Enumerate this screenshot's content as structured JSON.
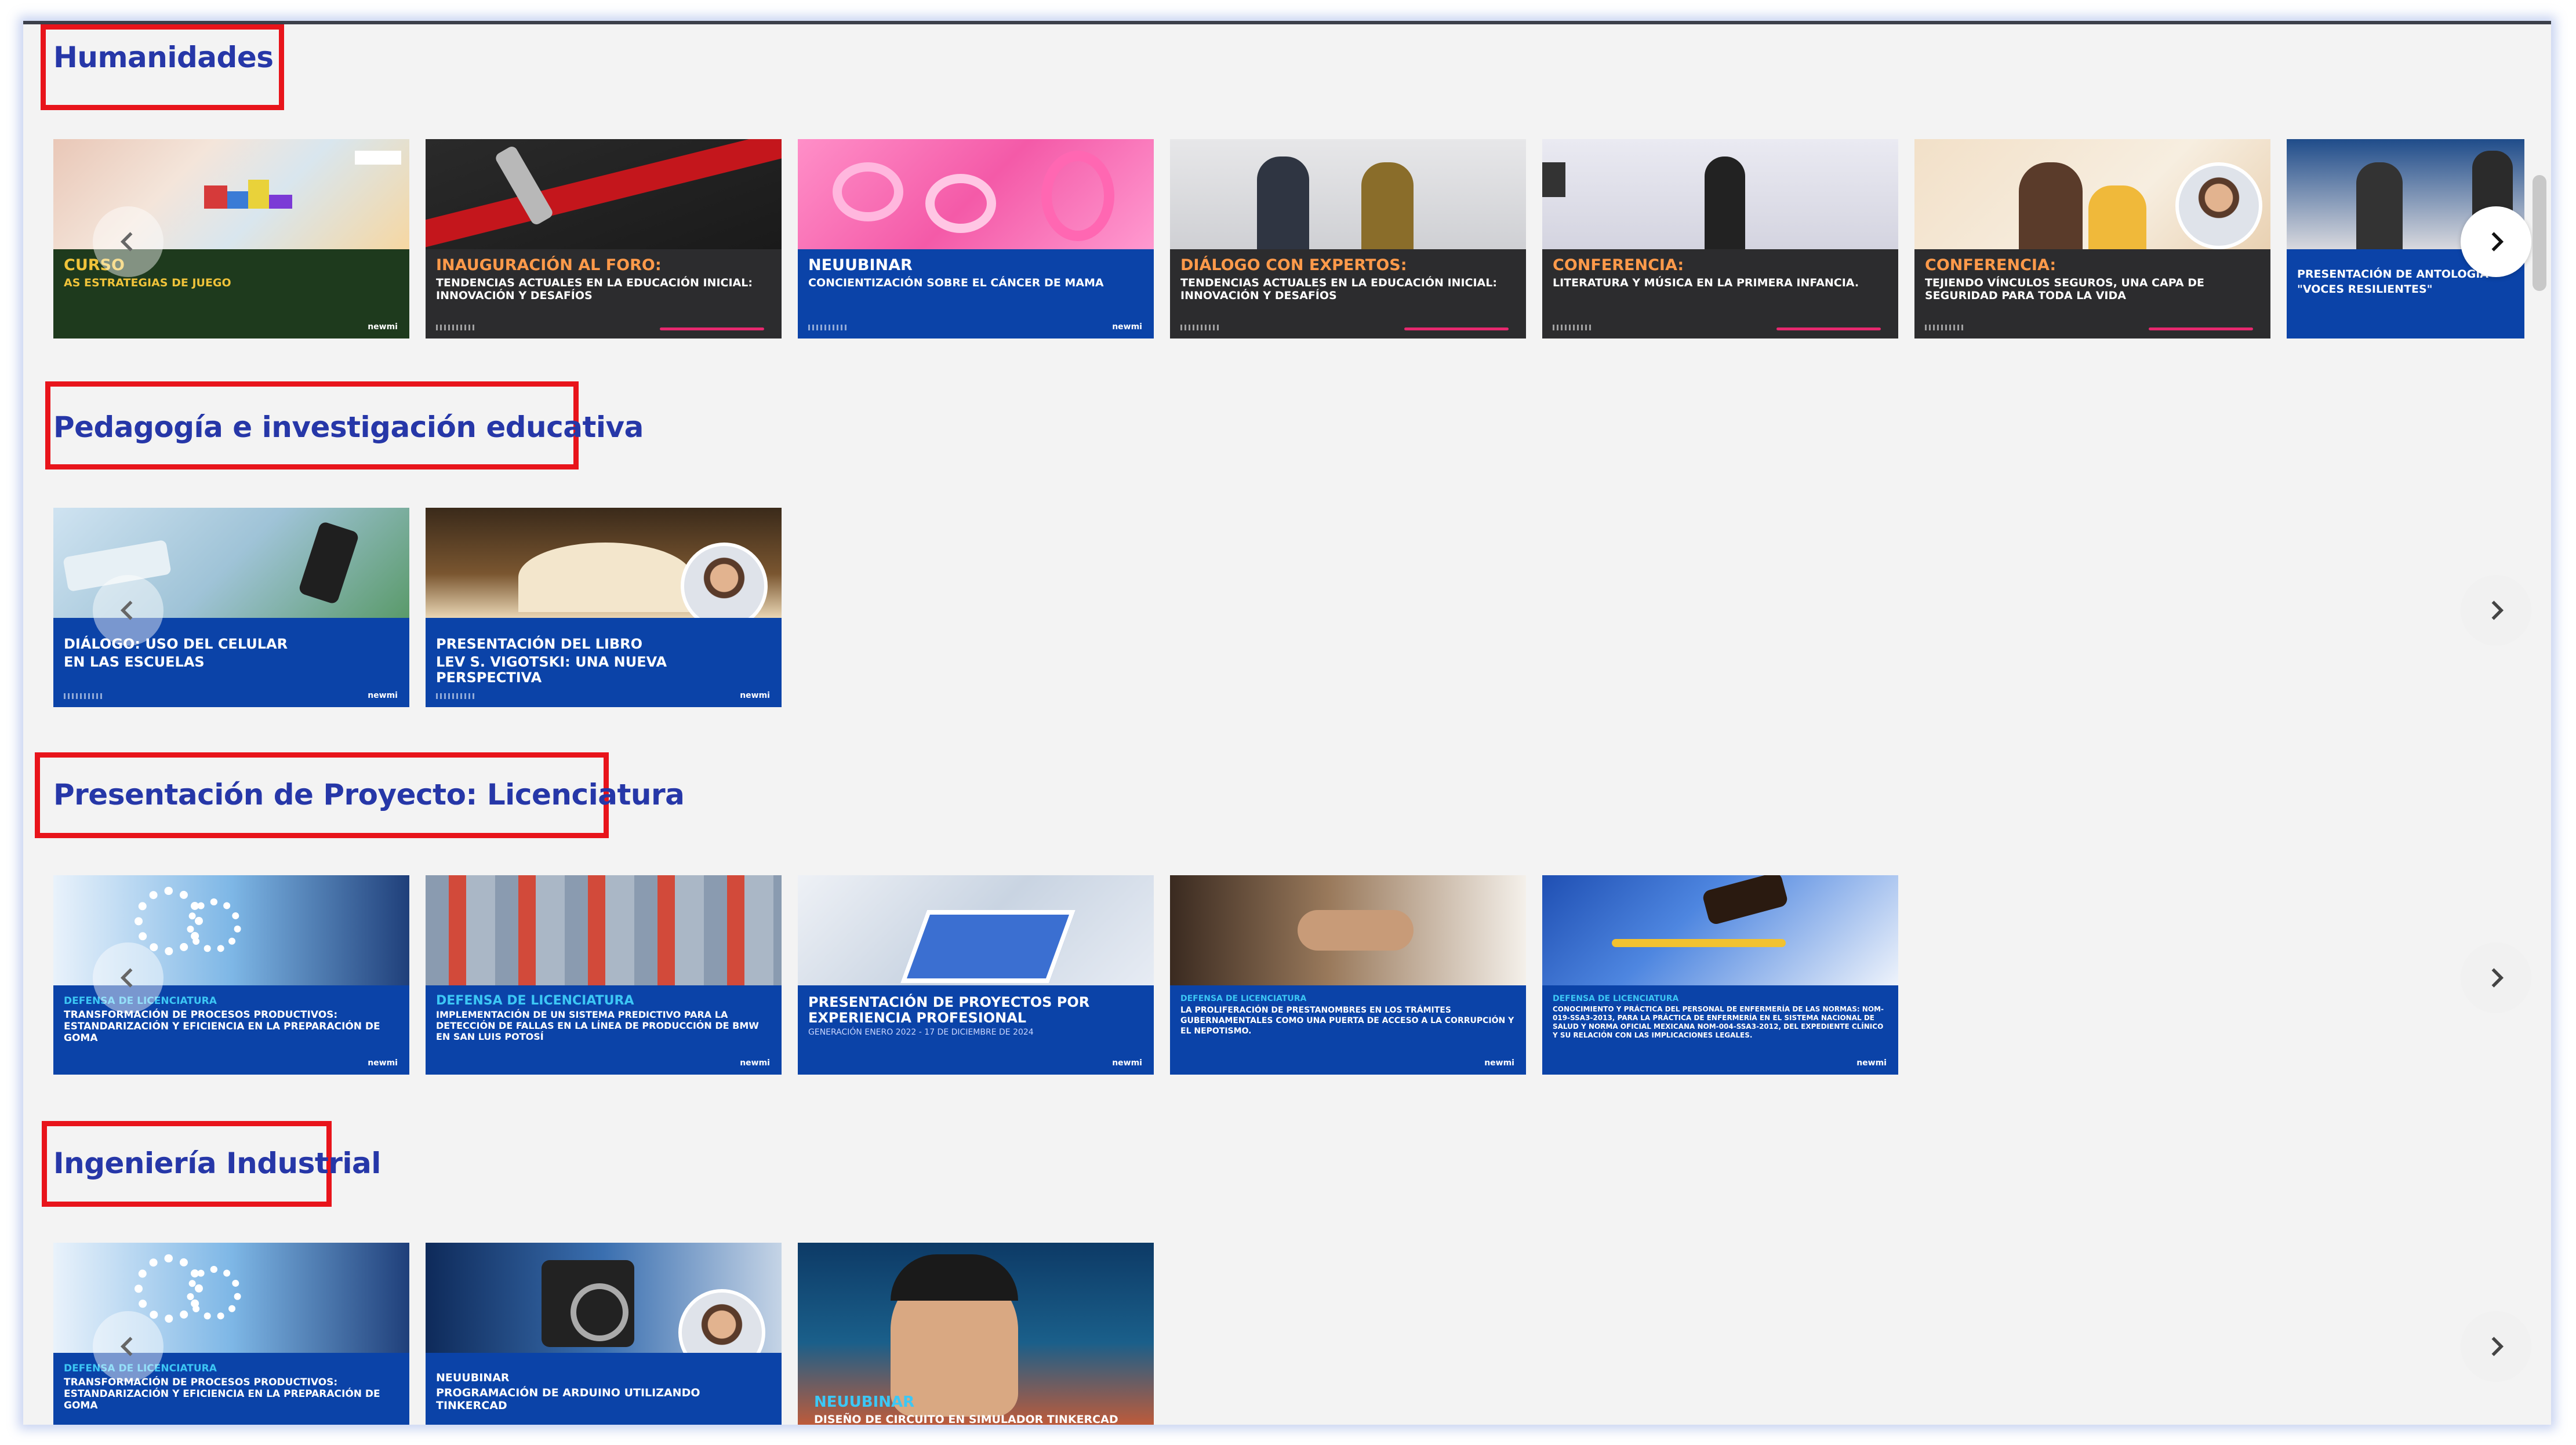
{
  "sections": [
    {
      "title": "Humanidades",
      "cards": [
        {
          "line1": "CURSO",
          "line2": "AS ESTRATEGIAS DE JUEGO",
          "brand": "newmi"
        },
        {
          "line1": "INAUGURACIÓN AL FORO:",
          "line2": "TENDENCIAS ACTUALES EN LA EDUCACIÓN INICIAL: INNOVACIÓN Y DESAFÍOS"
        },
        {
          "line1": "NEUUBINAR",
          "line2": "CONCIENTIZACIÓN SOBRE EL CÁNCER DE MAMA",
          "brand": "newmi"
        },
        {
          "line1": "DIÁLOGO CON EXPERTOS:",
          "line2": "TENDENCIAS ACTUALES EN LA EDUCACIÓN INICIAL: INNOVACIÓN Y DESAFÍOS"
        },
        {
          "line1": "CONFERENCIA:",
          "line2": "LITERATURA Y MÚSICA EN LA PRIMERA INFANCIA."
        },
        {
          "line1": "CONFERENCIA:",
          "line2": "TEJIENDO VÍNCULOS SEGUROS, UNA CAPA DE SEGURIDAD PARA TODA LA VIDA"
        },
        {
          "line1": "PRESENTACIÓN DE ANTOLOGÍA",
          "line2": "\"VOCES RESILIENTES\""
        }
      ]
    },
    {
      "title": "Pedagogía e investigación educativa",
      "cards": [
        {
          "line1": "DIÁLOGO: USO DEL CELULAR",
          "line2": "EN LAS ESCUELAS",
          "brand": "newmi"
        },
        {
          "line1": "PRESENTACIÓN DEL LIBRO",
          "line2": "LEV S. VIGOTSKI: UNA NUEVA PERSPECTIVA",
          "brand": "newmi"
        }
      ]
    },
    {
      "title": "Presentación de Proyecto: Licenciatura",
      "cards": [
        {
          "line1": "DEFENSA DE LICENCIATURA",
          "line2": "TRANSFORMACIÓN DE PROCESOS PRODUCTIVOS: ESTANDARIZACIÓN Y EFICIENCIA EN LA PREPARACIÓN DE GOMA",
          "brand": "newmi"
        },
        {
          "line1": "DEFENSA DE LICENCIATURA",
          "line2": "IMPLEMENTACIÓN DE UN SISTEMA PREDICTIVO PARA LA DETECCIÓN DE FALLAS EN LA LÍNEA DE PRODUCCIÓN DE BMW EN SAN LUIS POTOSÍ",
          "brand": "newmi"
        },
        {
          "line1": "PRESENTACIÓN DE PROYECTOS POR EXPERIENCIA PROFESIONAL",
          "line2": "GENERACIÓN ENERO 2022 - 17 DE DICIEMBRE DE 2024",
          "brand": "newmi"
        },
        {
          "line1": "DEFENSA DE LICENCIATURA",
          "line2": "LA PROLIFERACIÓN DE PRESTANOMBRES EN LOS TRÁMITES GUBERNAMENTALES COMO UNA PUERTA DE ACCESO A LA CORRUPCIÓN Y EL NEPOTISMO.",
          "brand": "newmi"
        },
        {
          "line1": "DEFENSA DE LICENCIATURA",
          "line2": "CONOCIMIENTO Y PRÁCTICA DEL PERSONAL DE ENFERMERÍA DE LAS NORMAS: NOM-019-SSA3-2013, PARA LA PRÁCTICA DE ENFERMERÍA EN EL SISTEMA NACIONAL DE SALUD Y NORMA OFICIAL MEXICANA NOM-004-SSA3-2012, DEL EXPEDIENTE CLÍNICO Y SU RELACIÓN CON LAS IMPLICACIONES LEGALES.",
          "brand": "newmi"
        }
      ]
    },
    {
      "title": "Ingeniería Industrial",
      "cards": [
        {
          "line1": "DEFENSA DE LICENCIATURA",
          "line2": "TRANSFORMACIÓN DE PROCESOS PRODUCTIVOS: ESTANDARIZACIÓN Y EFICIENCIA EN LA PREPARACIÓN DE GOMA"
        },
        {
          "line1": "NEUUBINAR",
          "line2": "PROGRAMACIÓN DE ARDUINO UTILIZANDO TINKERCAD"
        },
        {
          "line1": "NEUUBINAR",
          "line2": "DISEÑO DE CIRCUITO EN SIMULADOR TINKERCAD"
        }
      ]
    }
  ],
  "icons": {
    "prev": "chevron-left-icon",
    "next": "chevron-right-icon"
  },
  "colors": {
    "title": "#2637a8",
    "highlight": "#e8141b",
    "band_blue": "#0b43a8",
    "band_dark": "#2c2c2e"
  }
}
